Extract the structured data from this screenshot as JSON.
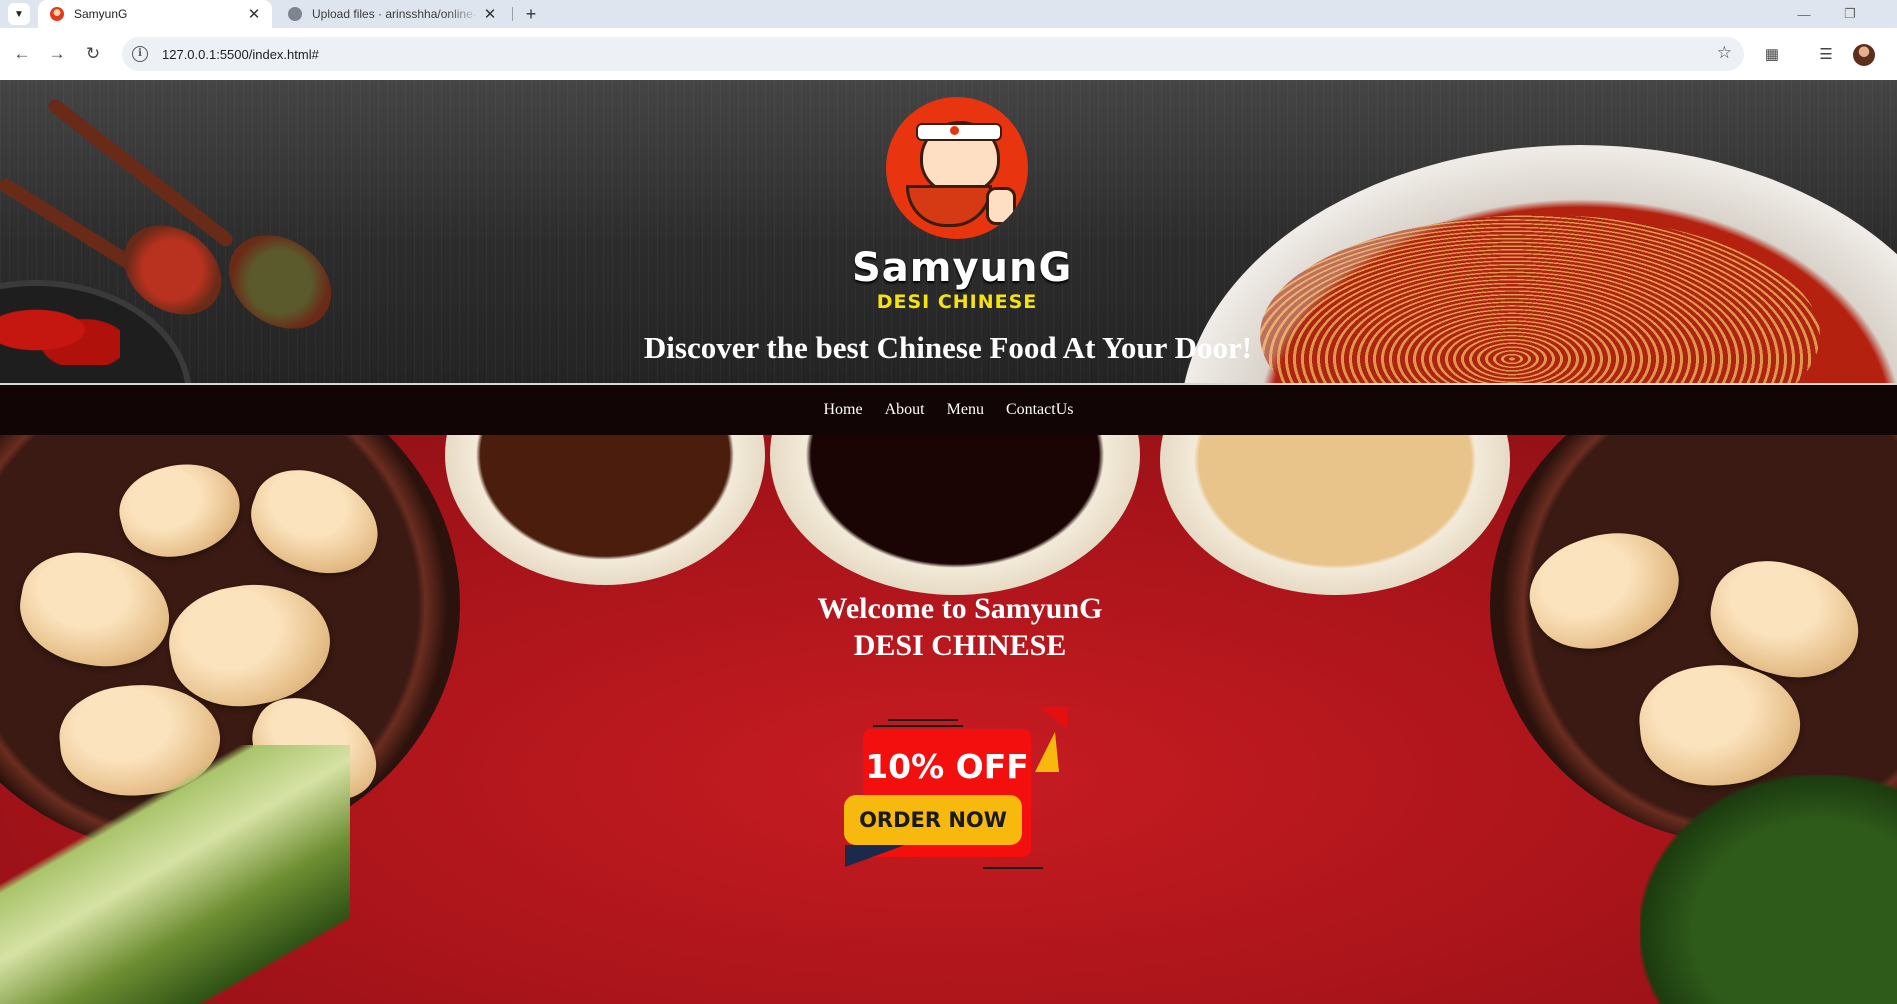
{
  "browser": {
    "tabs": [
      {
        "label": "SamyunG",
        "active": true
      },
      {
        "label": "Upload files · arinsshha/online-",
        "active": false
      }
    ],
    "url": "127.0.0.1:5500/index.html#"
  },
  "header": {
    "brand_name": "SamyunG",
    "brand_sub": "DESI CHINESE",
    "tagline": "Discover the best Chinese Food At Your Door!"
  },
  "nav": {
    "items": [
      "Home",
      "About",
      "Menu",
      "ContactUs"
    ]
  },
  "banner": {
    "welcome_line1": "Welcome to SamyunG",
    "welcome_line2": "DESI CHINESE",
    "promo_discount": "10% OFF",
    "promo_cta": "ORDER NOW"
  },
  "colors": {
    "navbar_bg": "#110505",
    "banner_red": "#c71c22",
    "brand_yellow": "#f5e20f",
    "promo_red": "#f40f0f",
    "promo_yellow": "#f7b90d"
  }
}
